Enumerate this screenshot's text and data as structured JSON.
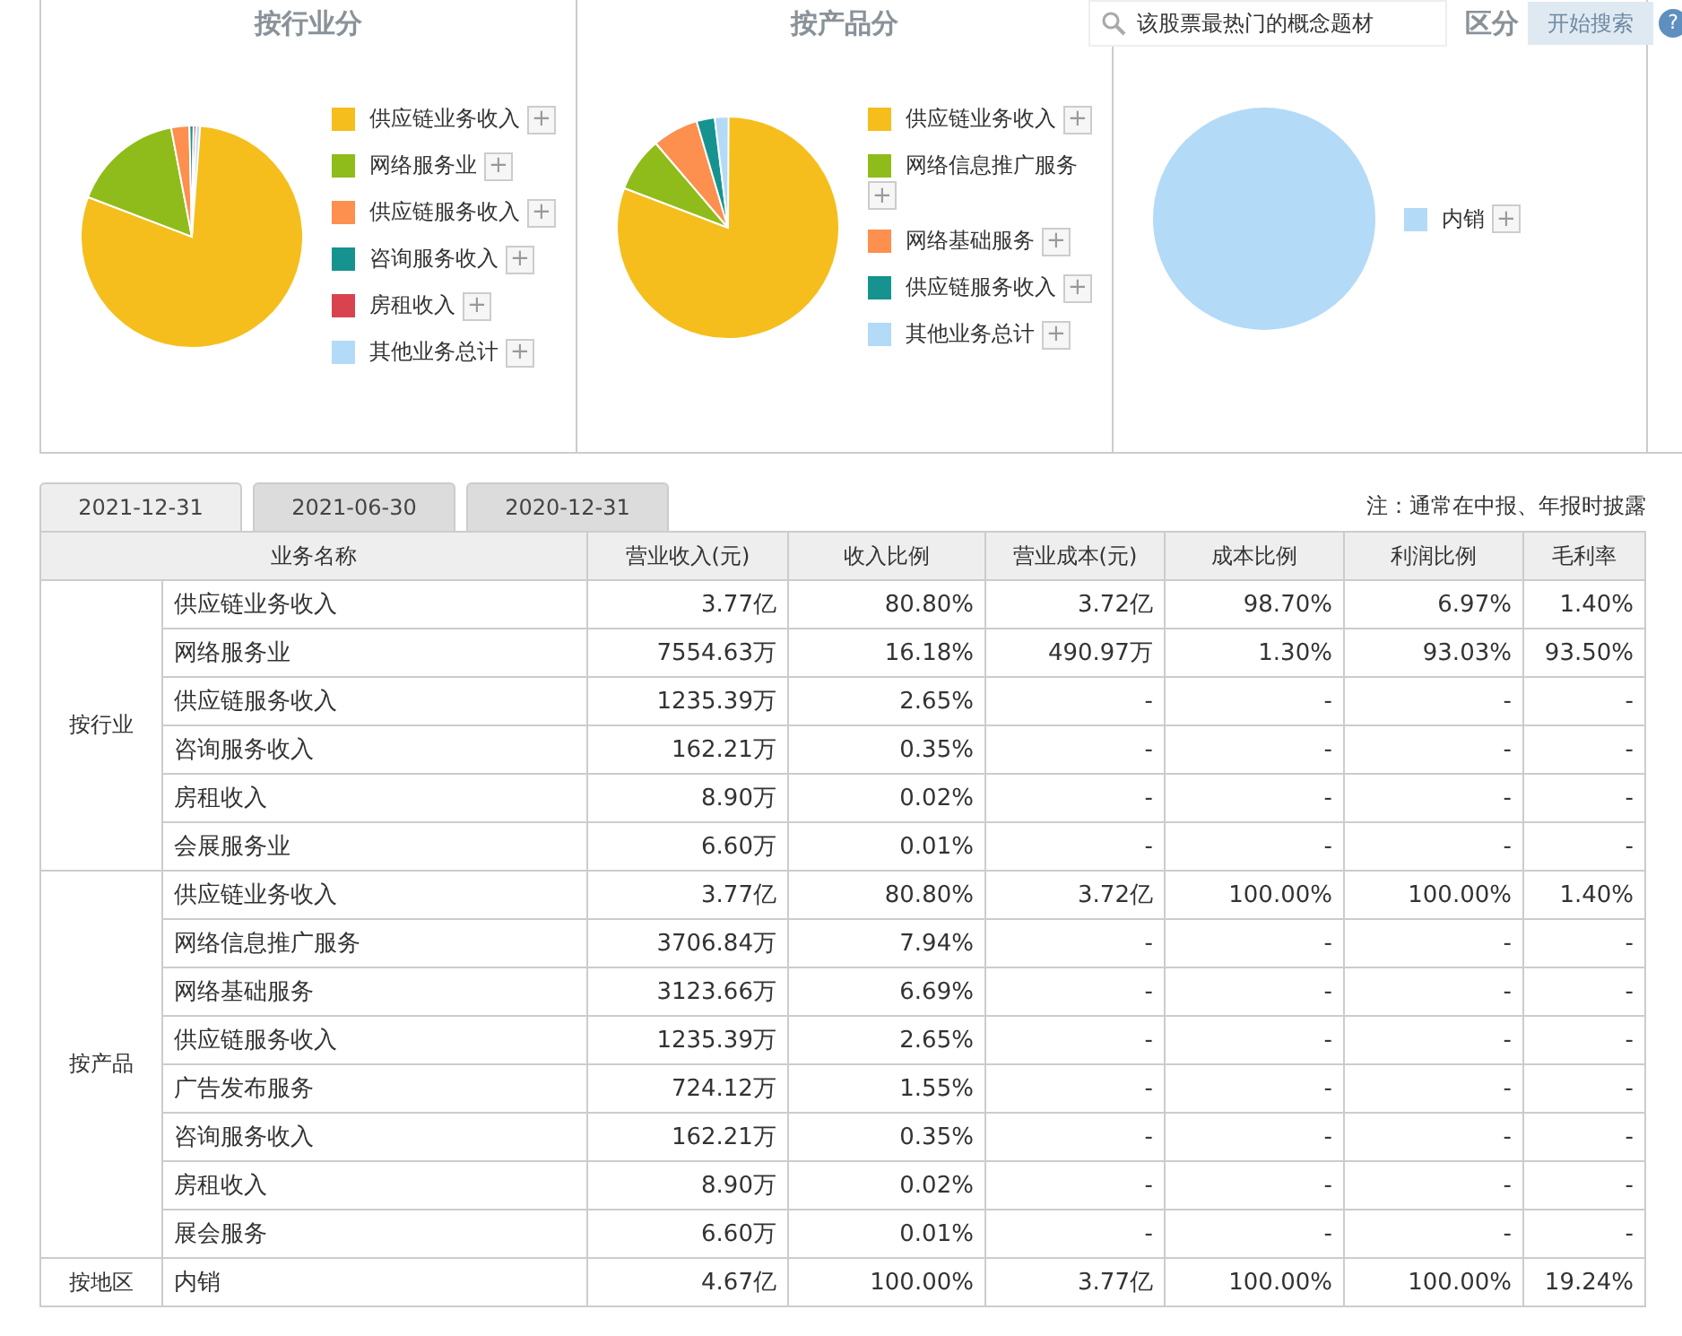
{
  "panels": [
    {
      "title": "按行业分",
      "legend": [
        {
          "label": "供应链业务收入",
          "color": "#f5be1c"
        },
        {
          "label": "网络服务业",
          "color": "#8fbc1a"
        },
        {
          "label": "供应链服务收入",
          "color": "#fd8f4f"
        },
        {
          "label": "咨询服务收入",
          "color": "#16938e"
        },
        {
          "label": "房租收入",
          "color": "#d9434f"
        },
        {
          "label": "其他业务总计",
          "color": "#b3daf7"
        }
      ]
    },
    {
      "title": "按产品分",
      "legend": [
        {
          "label": "供应链业务收入",
          "color": "#f5be1c"
        },
        {
          "label": "网络信息推广服务",
          "color": "#8fbc1a"
        },
        {
          "label": "网络基础服务",
          "color": "#fd8f4f"
        },
        {
          "label": "供应链服务收入",
          "color": "#16938e"
        },
        {
          "label": "其他业务总计",
          "color": "#b3daf7"
        }
      ]
    },
    {
      "title": "区分",
      "legend": [
        {
          "label": "内销",
          "color": "#b3daf7"
        }
      ]
    }
  ],
  "legend_button": "+",
  "search": {
    "placeholder": "该股票最热门的概念题材",
    "button": "开始搜索",
    "help": "?"
  },
  "tabs": [
    {
      "label": "2021-12-31",
      "selected": true
    },
    {
      "label": "2021-06-30",
      "selected": false
    },
    {
      "label": "2020-12-31",
      "selected": false
    }
  ],
  "note": "注：通常在中报、年报时披露",
  "table": {
    "columns": [
      "业务名称",
      "营业收入(元)",
      "收入比例",
      "营业成本(元)",
      "成本比例",
      "利润比例",
      "毛利率"
    ],
    "groups": [
      {
        "name": "按行业",
        "rows": [
          [
            "供应链业务收入",
            "3.77亿",
            "80.80%",
            "3.72亿",
            "98.70%",
            "6.97%",
            "1.40%"
          ],
          [
            "网络服务业",
            "7554.63万",
            "16.18%",
            "490.97万",
            "1.30%",
            "93.03%",
            "93.50%"
          ],
          [
            "供应链服务收入",
            "1235.39万",
            "2.65%",
            "-",
            "-",
            "-",
            "-"
          ],
          [
            "咨询服务收入",
            "162.21万",
            "0.35%",
            "-",
            "-",
            "-",
            "-"
          ],
          [
            "房租收入",
            "8.90万",
            "0.02%",
            "-",
            "-",
            "-",
            "-"
          ],
          [
            "会展服务业",
            "6.60万",
            "0.01%",
            "-",
            "-",
            "-",
            "-"
          ]
        ]
      },
      {
        "name": "按产品",
        "rows": [
          [
            "供应链业务收入",
            "3.77亿",
            "80.80%",
            "3.72亿",
            "100.00%",
            "100.00%",
            "1.40%"
          ],
          [
            "网络信息推广服务",
            "3706.84万",
            "7.94%",
            "-",
            "-",
            "-",
            "-"
          ],
          [
            "网络基础服务",
            "3123.66万",
            "6.69%",
            "-",
            "-",
            "-",
            "-"
          ],
          [
            "供应链服务收入",
            "1235.39万",
            "2.65%",
            "-",
            "-",
            "-",
            "-"
          ],
          [
            "广告发布服务",
            "724.12万",
            "1.55%",
            "-",
            "-",
            "-",
            "-"
          ],
          [
            "咨询服务收入",
            "162.21万",
            "0.35%",
            "-",
            "-",
            "-",
            "-"
          ],
          [
            "房租收入",
            "8.90万",
            "0.02%",
            "-",
            "-",
            "-",
            "-"
          ],
          [
            "展会服务",
            "6.60万",
            "0.01%",
            "-",
            "-",
            "-",
            "-"
          ]
        ]
      },
      {
        "name": "按地区",
        "rows": [
          [
            "内销",
            "4.67亿",
            "100.00%",
            "3.77亿",
            "100.00%",
            "100.00%",
            "19.24%"
          ]
        ]
      }
    ]
  }
}
